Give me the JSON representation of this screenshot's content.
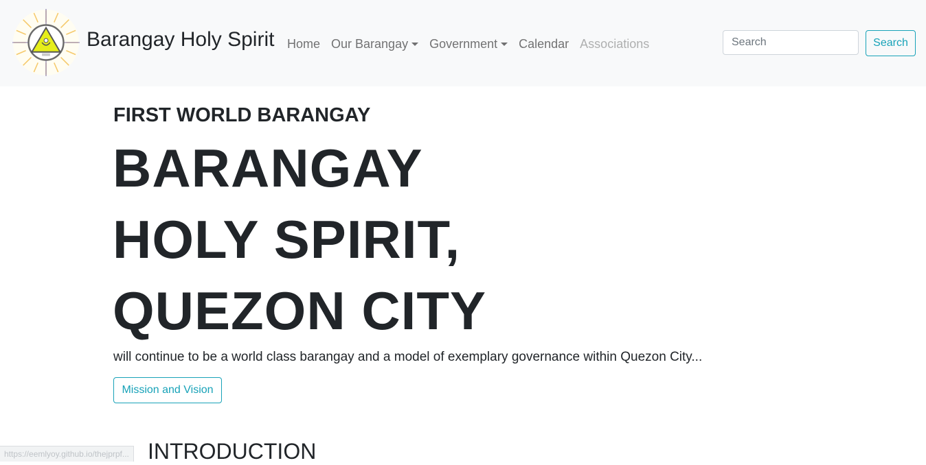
{
  "navbar": {
    "brand": "Barangay Holy Spirit",
    "logo_icon": "barangay-seal-icon",
    "links": [
      {
        "label": "Home",
        "dropdown": false,
        "disabled": false
      },
      {
        "label": "Our Barangay",
        "dropdown": true,
        "disabled": false
      },
      {
        "label": "Government",
        "dropdown": true,
        "disabled": false
      },
      {
        "label": "Calendar",
        "dropdown": false,
        "disabled": false
      },
      {
        "label": "Associations",
        "dropdown": false,
        "disabled": true
      }
    ],
    "search": {
      "placeholder": "Search",
      "value": "",
      "button_label": "Search"
    }
  },
  "hero": {
    "kicker": "FIRST WORLD BARANGAY",
    "title_lines": [
      "BARANGAY",
      "HOLY SPIRIT,",
      "QUEZON CITY"
    ],
    "lead": "will continue to be a world class barangay and a model of exemplary governance within Quezon City...",
    "button_label": "Mission and Vision"
  },
  "intro_heading": "INTRODUCTION",
  "status_bar_url": "https://eemlyoy.github.io/thejprpf...",
  "colors": {
    "accent": "#17a2b8",
    "navbar_bg": "#f8f9fa",
    "text": "#212529"
  }
}
